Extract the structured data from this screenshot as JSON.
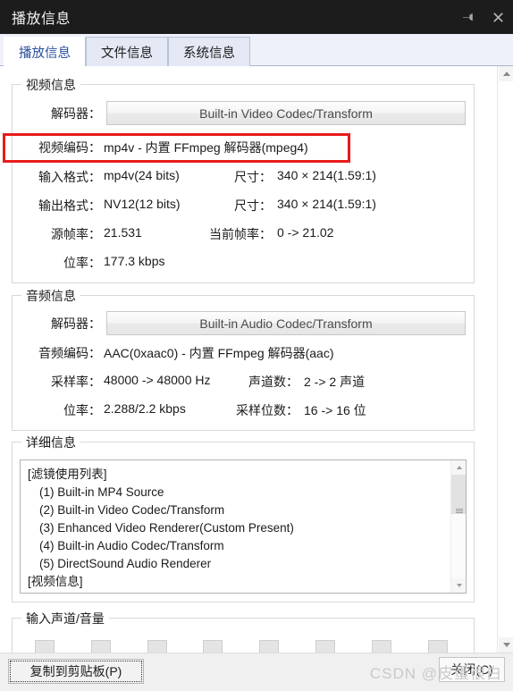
{
  "window": {
    "title": "播放信息",
    "pin_icon": "pin-icon",
    "close_icon": "close-icon"
  },
  "tabs": [
    {
      "label": "播放信息",
      "active": true
    },
    {
      "label": "文件信息",
      "active": false
    },
    {
      "label": "系统信息",
      "active": false
    }
  ],
  "video_group": {
    "title": "视频信息",
    "decoder_label": "解码器：",
    "decoder_button": "Built-in Video Codec/Transform",
    "rows": [
      {
        "label": "视频编码：",
        "value": "mp4v - 内置 FFmpeg 解码器(mpeg4)",
        "highlighted": true
      },
      {
        "label": "输入格式：",
        "value": "mp4v(24 bits)",
        "label2": "尺寸：",
        "value2": "340 × 214(1.59:1)"
      },
      {
        "label": "输出格式：",
        "value": "NV12(12 bits)",
        "label2": "尺寸：",
        "value2": "340 × 214(1.59:1)"
      },
      {
        "label": "源帧率：",
        "value": "21.531",
        "label2": "当前帧率：",
        "value2": "0 -> 21.02"
      },
      {
        "label": "位率：",
        "value": "177.3 kbps"
      }
    ]
  },
  "audio_group": {
    "title": "音频信息",
    "decoder_label": "解码器：",
    "decoder_button": "Built-in Audio Codec/Transform",
    "rows": [
      {
        "label": "音频编码：",
        "value": "AAC(0xaac0) - 内置 FFmpeg 解码器(aac)"
      },
      {
        "label": "采样率：",
        "value": "48000 -> 48000 Hz",
        "label2": "声道数：",
        "value2": "2 -> 2 声道"
      },
      {
        "label": "位率：",
        "value": "2.288/2.2 kbps",
        "label2": "采样位数：",
        "value2": "16 -> 16 位"
      }
    ]
  },
  "details_group": {
    "title": "详细信息",
    "lines": [
      {
        "text": "[滤镜使用列表]",
        "indent": false
      },
      {
        "text": "(1) Built-in MP4 Source",
        "indent": true
      },
      {
        "text": "(2) Built-in Video Codec/Transform",
        "indent": true
      },
      {
        "text": "(3) Enhanced Video Renderer(Custom Present)",
        "indent": true
      },
      {
        "text": "(4) Built-in Audio Codec/Transform",
        "indent": true
      },
      {
        "text": "(5) DirectSound Audio Renderer",
        "indent": true
      },
      {
        "text": "",
        "indent": false
      },
      {
        "text": "[视频信息]",
        "indent": false
      }
    ]
  },
  "channel_group": {
    "title": "输入声道/音量",
    "slot_count": 8
  },
  "bottom": {
    "copy_button": "复制到剪贴板(P)",
    "close_button": "关闭(C)",
    "watermark": "CSDN @皮蛋很白"
  },
  "colors": {
    "titlebar_bg": "#1c1c1c",
    "tab_active_text": "#2b4f9e",
    "highlight_red": "#e81b1b",
    "watermark": "#c9c9c9"
  }
}
